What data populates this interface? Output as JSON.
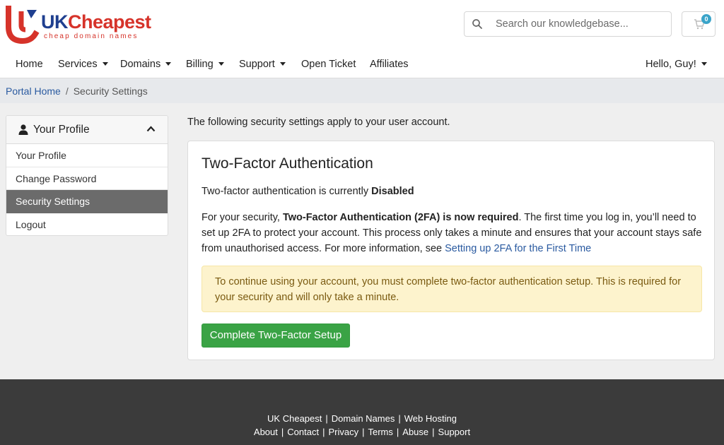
{
  "brand": {
    "name_part1": "UK",
    "name_part2": "Cheapest",
    "tagline": "cheap domain names",
    "primary_color": "#1f3f8f",
    "accent_color": "#d6332a"
  },
  "search": {
    "placeholder": "Search our knowledgebase..."
  },
  "cart": {
    "count": "0"
  },
  "nav": {
    "items": [
      {
        "label": "Home",
        "dropdown": false
      },
      {
        "label": "Services",
        "dropdown": true
      },
      {
        "label": "Domains",
        "dropdown": true
      },
      {
        "label": "Billing",
        "dropdown": true
      },
      {
        "label": "Support",
        "dropdown": true
      },
      {
        "label": "Open Ticket",
        "dropdown": false
      },
      {
        "label": "Affiliates",
        "dropdown": false
      }
    ],
    "user_greeting": "Hello, Guy!"
  },
  "breadcrumb": {
    "home": "Portal Home",
    "separator": "/",
    "current": "Security Settings"
  },
  "sidebar": {
    "title": "Your Profile",
    "items": [
      {
        "label": "Your Profile",
        "active": false
      },
      {
        "label": "Change Password",
        "active": false
      },
      {
        "label": "Security Settings",
        "active": true
      },
      {
        "label": "Logout",
        "active": false
      }
    ]
  },
  "main": {
    "intro": "The following security settings apply to your user account.",
    "card": {
      "title": "Two-Factor Authentication",
      "status_prefix": "Two-factor authentication is currently ",
      "status_value": "Disabled",
      "para_prefix": "For your security, ",
      "para_bold": "Two-Factor Authentication (2FA) is now required",
      "para_body": ". The first time you log in, you’ll need to set up 2FA to protect your account. This process only takes a minute and ensures that your account stays safe from unauthorised access. For more information, see ",
      "para_link": "Setting up 2FA for the First Time",
      "alert": "To continue using your account, you must complete two-factor authentication setup. This is required for your security and will only take a minute.",
      "button": "Complete Two-Factor Setup"
    }
  },
  "footer": {
    "line1": [
      "UK Cheapest",
      "Domain Names",
      "Web Hosting"
    ],
    "line2": [
      "About",
      "Contact",
      "Privacy",
      "Terms",
      "Abuse",
      "Support"
    ],
    "separator": "|"
  }
}
